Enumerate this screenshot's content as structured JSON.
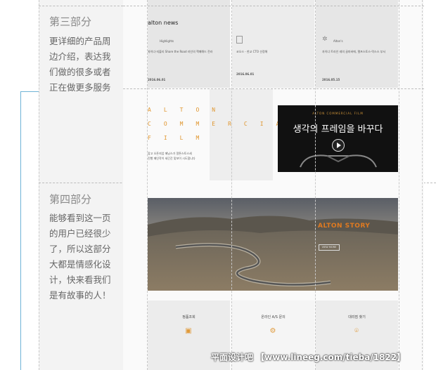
{
  "annotations": {
    "section3": {
      "title": "第三部分",
      "lines": [
        "更详细的产品周",
        "边介绍，表达我",
        "们做的很多或者",
        "正在做更多服务"
      ]
    },
    "section4": {
      "title": "第四部分",
      "lines": [
        "能够看到这一页",
        "的用户已经很少",
        "了，所以这部分",
        "大都是情感化设",
        "计，快来看我们",
        "是有故事的人！"
      ]
    }
  },
  "mockup": {
    "news_heading": "alton news",
    "news_cards": [
      {
        "tag": "Highlights",
        "headline": "자이너-지불리 Share the Road 라인의 핵폐해드 전라",
        "date": "2016.06.01"
      },
      {
        "tag": "",
        "headline": "코오스 - 한교 CTO 선정해",
        "date": "2016.06.01"
      },
      {
        "tag": "Alton's",
        "headline": "자이너 트라인 레의 골마바에, 랠프스토스-락스스 부서",
        "date": "2016.05.15"
      }
    ],
    "film_lines": [
      "ALTON",
      "COMMERCIAL",
      "FILM"
    ],
    "film_caption": [
      "잡고 오픈지업 메닝스가 알톤스토스세",
      "진행 메인작이 세긴간 맞보이 시도합니다"
    ],
    "video": {
      "subtitle": "ALTON COMMERCIAL FILM",
      "headline": "생각의 프레임을 바꾸다"
    },
    "story": {
      "title": "ALTON STORY",
      "button": "VIEW MORE"
    },
    "services": [
      {
        "title": "정품조회",
        "icon": "search-icon"
      },
      {
        "title": "온라인 A/S 문의",
        "icon": "tools-icon"
      },
      {
        "title": "대리점 찾기",
        "icon": "location-icon"
      }
    ]
  },
  "watermark": "平面设计吧 【www.lineeg.com/tieba/1822】",
  "colors": {
    "accent": "#e0962e",
    "annotation_line": "#6fb3d6"
  }
}
